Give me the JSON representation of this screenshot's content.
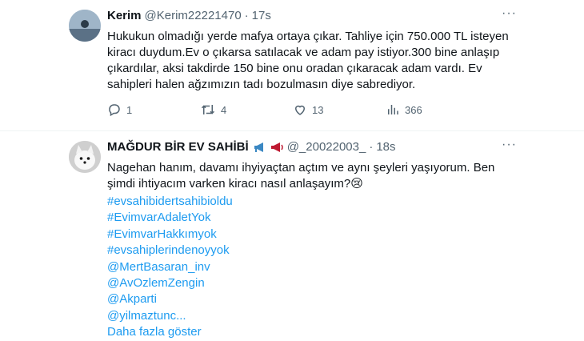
{
  "tweets": [
    {
      "name": "Kerim",
      "handle": "@Kerim22221470",
      "dot": "·",
      "time": "17s",
      "more": "···",
      "text": "Hukukun olmadığı yerde mafya ortaya çıkar. Tahliye için 750.000 TL isteyen kiracı duydum.Ev o çıkarsa satılacak ve adam pay istiyor.300 bine anlaşıp çıkardılar, aksi takdirde 150 bine onu oradan çıkaracak adam vardı. Ev sahipleri halen ağzımızın tadı bozulmasın diye sabrediyor.",
      "actions": {
        "replies": "1",
        "retweets": "4",
        "likes": "13",
        "views": "366"
      }
    },
    {
      "name": "MAĞDUR BİR EV SAHİBİ",
      "handle": "@_20022003_",
      "dot": "·",
      "time": "18s",
      "more": "···",
      "text": "Nagehan hanım, davamı ihyiyaçtan açtım ve  aynı şeyleri yaşıyorum. Ben şimdi ihtiyacım varken kiracı nasıl anlaşayım?😢",
      "tags": [
        "#evsahibidertsahibioldu",
        "#EvimvarAdaletYok",
        "#EvimvarHakkımyok",
        "#evsahiplerindenoyyok",
        "@MertBasaran_inv",
        "@AvOzlemZengin",
        "@Akparti",
        "@yilmaztunc..."
      ],
      "show_more": "Daha fazla göster"
    }
  ],
  "icons": [
    "reply-icon",
    "retweet-icon",
    "like-icon",
    "views-icon",
    "megaphone-icon",
    "loudspeaker-icon",
    "more-icon"
  ],
  "colors": {
    "link": "#1d9bf0",
    "muted": "#536471",
    "text": "#0f1419",
    "divider": "#eff3f4"
  }
}
